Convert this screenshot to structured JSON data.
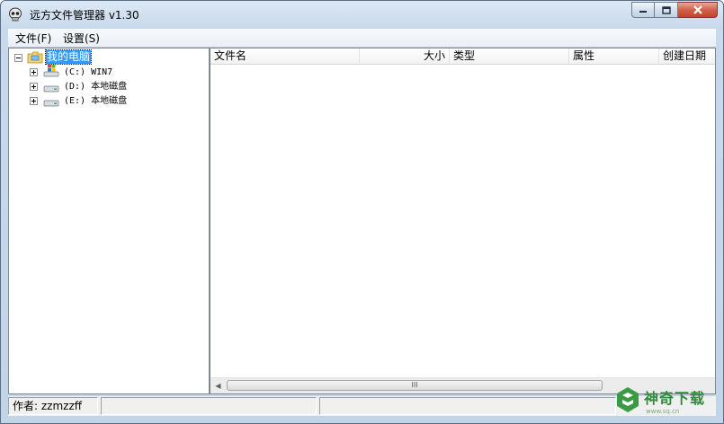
{
  "window": {
    "title": "远方文件管理器 v1.30",
    "icon": "skull-icon",
    "controls": [
      "minimize-icon",
      "maximize-icon",
      "close-icon"
    ]
  },
  "menu": [
    {
      "label": "文件(F)"
    },
    {
      "label": "设置(S)"
    }
  ],
  "tree": {
    "root": {
      "label": "我的电脑",
      "icon": "computer-folder-icon",
      "expanded": true,
      "selected": true
    },
    "children": [
      {
        "label": "(C:) WIN7",
        "icon": "windows-drive-icon"
      },
      {
        "label": "(D:) 本地磁盘",
        "icon": "hard-drive-icon"
      },
      {
        "label": "(E:) 本地磁盘",
        "icon": "hard-drive-icon"
      }
    ]
  },
  "list": {
    "columns": [
      "文件名",
      "大小",
      "类型",
      "属性",
      "创建日期"
    ],
    "rows": [],
    "scroll_grip": "III"
  },
  "status": {
    "author": "作者: zzmzzff",
    "panel2": "",
    "panel3": ""
  },
  "watermark": {
    "text": "神奇下载",
    "url": "www.sq.cn"
  },
  "colors": {
    "selection": "#3399ff",
    "frame": "#c2d4e8",
    "close_button": "#c2432b",
    "watermark": "#2f8a3a"
  }
}
